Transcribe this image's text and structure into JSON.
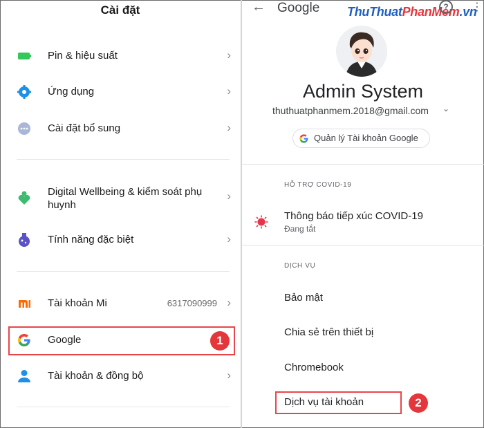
{
  "settings": {
    "title": "Cài đặt",
    "items": [
      {
        "label": "Pin & hiệu suất",
        "icon": "battery-icon"
      },
      {
        "label": "Ứng dụng",
        "icon": "apps-gear-icon"
      },
      {
        "label": "Cài đặt bổ sung",
        "icon": "more-dots-icon"
      },
      {
        "label": "Digital Wellbeing & kiểm soát phụ",
        "label2": "huynh",
        "icon": "wellbeing-icon"
      },
      {
        "label": "Tính năng đặc biệt",
        "icon": "special-features-icon"
      },
      {
        "label": "Tài khoản Mi",
        "value": "6317090999",
        "icon": "mi-logo-icon"
      },
      {
        "label": "Google",
        "icon": "google-g-icon"
      },
      {
        "label": "Tài khoản & đồng bộ",
        "icon": "account-person-icon"
      }
    ],
    "step1": "1"
  },
  "google": {
    "title": "Google",
    "watermark": {
      "part1": "ThuThuat",
      "part2": "PhanMem",
      "part3": ".vn"
    },
    "help": "?",
    "account": {
      "name": "Admin System",
      "email": "thuthuatphanmem.2018@gmail.com",
      "manage_label": "Quản lý Tài khoản Google"
    },
    "covid": {
      "section": "HỖ TRỢ COVID-19",
      "title": "Thông báo tiếp xúc COVID-19",
      "status": "Đang tắt"
    },
    "services": {
      "section": "DỊCH VỤ",
      "items": [
        "Bảo mật",
        "Chia sẻ trên thiết bị",
        "Chromebook",
        "Dịch vụ tài khoản"
      ]
    },
    "step2": "2"
  },
  "colors": {
    "highlight": "#e8454a",
    "badge": "#e4373b",
    "battery": "#34c759",
    "apps": "#1e90e8",
    "wellbeing": "#3dbb6f",
    "special": "#5b52c8",
    "mi": "#ff6900",
    "account": "#1e90e8",
    "covid": "#e8344a"
  }
}
